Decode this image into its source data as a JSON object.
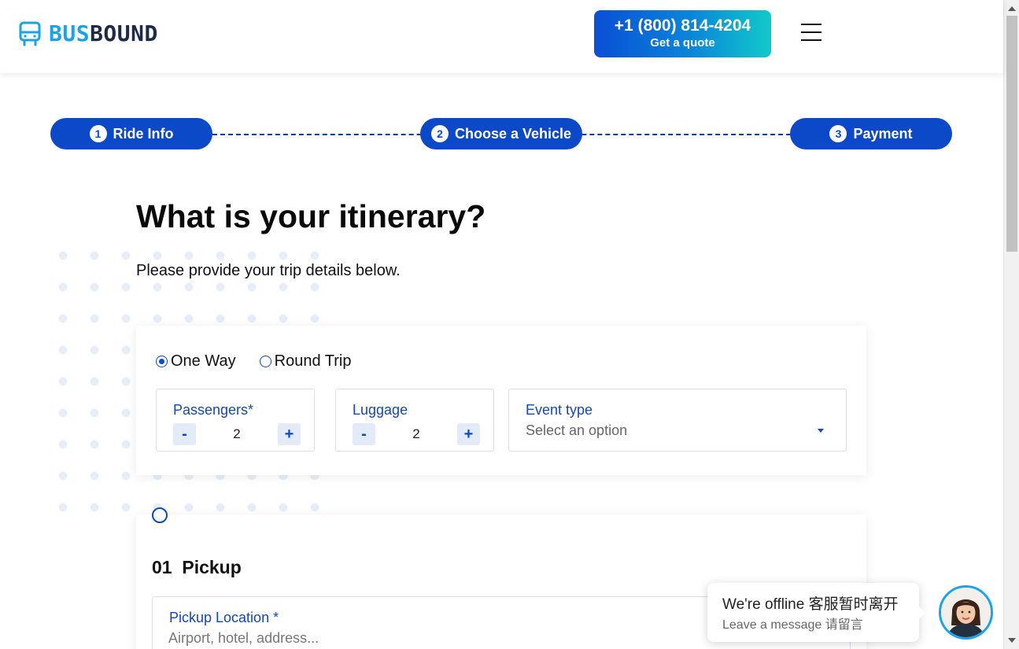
{
  "brand": {
    "name_part1": "BUS",
    "name_part2": "BOUND",
    "colors": {
      "accent": "#1aa3e8",
      "dark": "#1f2a44",
      "primary": "#0b49c9"
    }
  },
  "header": {
    "phone": "+1 (800) 814-4204",
    "quote_label": "Get a quote",
    "menu_icon": "hamburger-menu-icon"
  },
  "steps": [
    {
      "num": "1",
      "label": "Ride Info"
    },
    {
      "num": "2",
      "label": "Choose a Vehicle"
    },
    {
      "num": "3",
      "label": "Payment"
    }
  ],
  "page": {
    "title": "What is your itinerary?",
    "subtitle": "Please provide your trip details below."
  },
  "trip": {
    "options": [
      {
        "label": "One Way",
        "selected": true
      },
      {
        "label": "Round Trip",
        "selected": false
      }
    ],
    "passengers": {
      "label": "Passengers*",
      "value": "2",
      "minus": "-",
      "plus": "+"
    },
    "luggage": {
      "label": "Luggage",
      "value": "2",
      "minus": "-",
      "plus": "+"
    },
    "event_type": {
      "label": "Event type",
      "value": "Select an option"
    }
  },
  "pickup": {
    "title": "01  Pickup",
    "location_label": "Pickup Location *",
    "location_placeholder": "Airport, hotel, address..."
  },
  "chat": {
    "title": "We're offline 客服暂时离开",
    "subtitle": "Leave a message 请留言"
  }
}
